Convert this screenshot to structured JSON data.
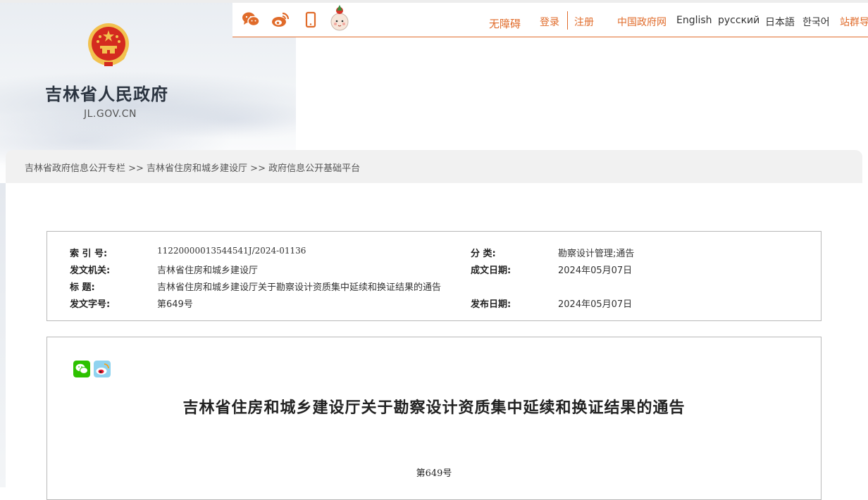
{
  "site": {
    "name": "吉林省人民政府",
    "domain": "JL.GOV.CN"
  },
  "toolbar": {
    "icons": [
      "wechat-icon",
      "weibo-icon",
      "mobile-icon",
      "mascot-icon"
    ],
    "accessibility": "无障碍",
    "login": "登录",
    "register": "注册",
    "gov_portal": "中国政府网",
    "lang_en": "English",
    "lang_ru": "русский",
    "lang_ja": "日本語",
    "lang_ko": "한국어",
    "site_group": "站群导"
  },
  "breadcrumb": "吉林省政府信息公开专栏 >> 吉林省住房和城乡建设厅 >> 政府信息公开基础平台",
  "meta": {
    "index_label": "索 引 号:",
    "index_value": "11220000013544541J/2024-01136",
    "category_label": "分    类:",
    "category_value": "勘察设计管理;通告",
    "issuer_label": "发文机关:",
    "issuer_value": "吉林省住房和城乡建设厅",
    "written_date_label": "成文日期:",
    "written_date_value": "2024年05月07日",
    "title_label": "标      题:",
    "title_value": "吉林省住房和城乡建设厅关于勘察设计资质集中延续和换证结果的通告",
    "doc_no_label": "发文字号:",
    "doc_no_value": "第649号",
    "publish_date_label": "发布日期:",
    "publish_date_value": "2024年05月07日"
  },
  "article": {
    "share_icons": [
      "wechat-share-icon",
      "weibo-share-icon"
    ],
    "title": "吉林省住房和城乡建设厅关于勘察设计资质集中延续和换证结果的通告",
    "number": "第649号"
  },
  "colors": {
    "accent": "#e06b2a",
    "emblem_red": "#d42a1f",
    "emblem_gold": "#f2c14e",
    "wechat": "#2dc100"
  }
}
